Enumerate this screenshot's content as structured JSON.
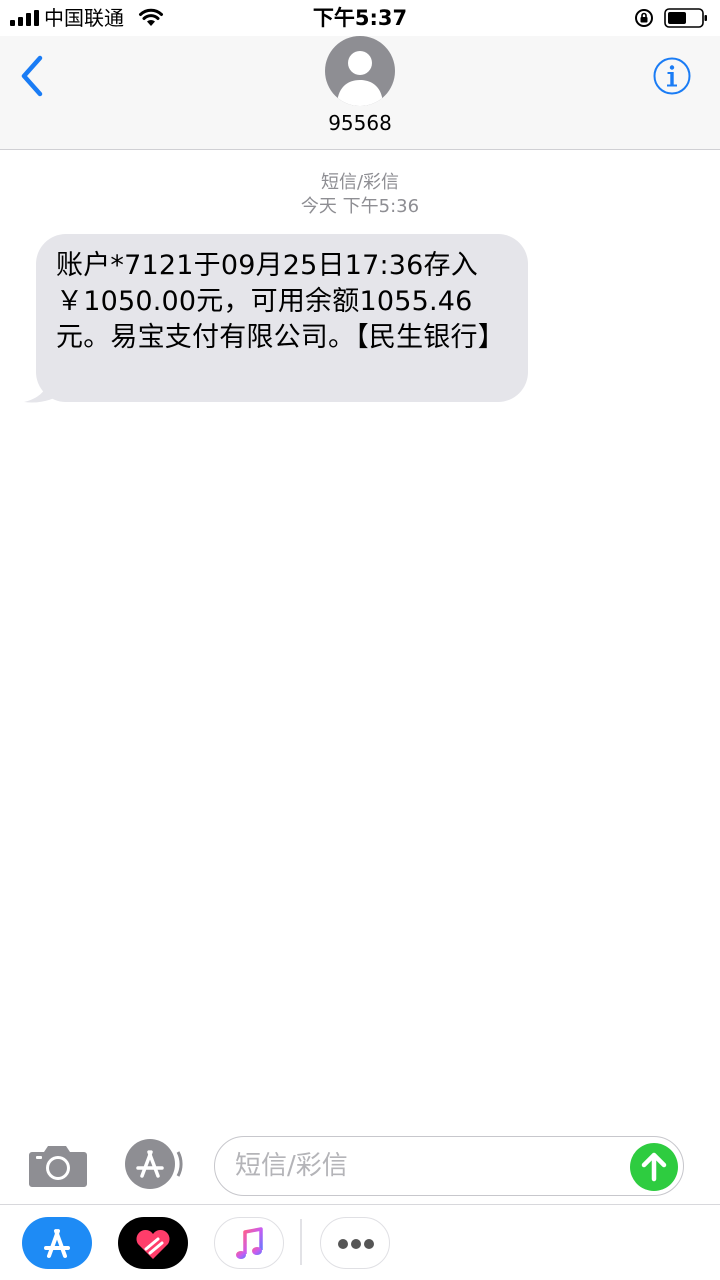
{
  "status_bar": {
    "carrier": "中国联通",
    "time": "下午5:37"
  },
  "header": {
    "contact": "95568"
  },
  "conversation": {
    "type_label": "短信/彩信",
    "timestamp": "今天 下午5:36",
    "messages": [
      {
        "text": "账户*7121于09月25日17:36存入￥1050.00元，可用余额1055.46元。易宝支付有限公司。【民生银行】",
        "direction": "incoming"
      }
    ]
  },
  "compose": {
    "placeholder": "短信/彩信"
  },
  "icons": {
    "back": "chevron-left-icon",
    "info": "info-icon",
    "camera": "camera-icon",
    "apps": "app-store-icon",
    "send": "arrow-up-icon",
    "drawer": [
      "app-store-icon",
      "digital-touch-icon",
      "music-icon",
      "more-icon"
    ]
  },
  "colors": {
    "accent": "#1a7cf5",
    "bubble_incoming": "#e5e5ea",
    "send": "#2ecc40",
    "meta_text": "#8e8e93"
  }
}
